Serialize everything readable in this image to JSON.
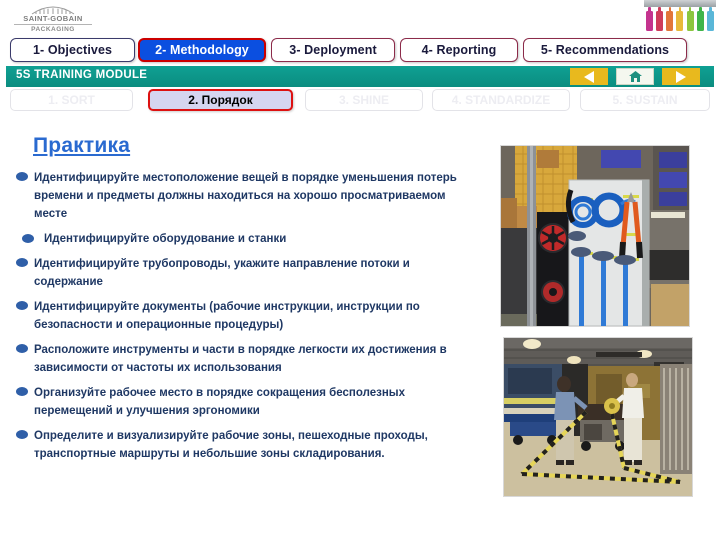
{
  "brand": {
    "name": "SAINT-GOBAIN",
    "division": "PACKAGING",
    "logo_icon": "saint-gobain-arch-icon",
    "bottles_icon": "colored-bottles-icon",
    "bottle_colors": [
      "#c4338e",
      "#cf3b5a",
      "#e2753a",
      "#e8b93a",
      "#8cc63f",
      "#3fb54a",
      "#5ab7d8"
    ]
  },
  "main_tabs": [
    {
      "label": "1- Objectives",
      "active": false
    },
    {
      "label": "2- Methodology",
      "active": true
    },
    {
      "label": "3- Deployment",
      "active": false
    },
    {
      "label": "4- Reporting",
      "active": false
    },
    {
      "label": "5- Recommendations",
      "active": false
    }
  ],
  "module_bar": {
    "title": "5S TRAINING MODULE",
    "prev_icon": "previous-arrow-icon",
    "home_icon": "home-icon",
    "next_icon": "next-arrow-icon"
  },
  "sub_tabs": [
    {
      "label": "1. SORT",
      "active": false
    },
    {
      "label": "2. Порядок",
      "active": true
    },
    {
      "label": "3. SHINE",
      "active": false
    },
    {
      "label": "4. STANDARDIZE",
      "active": false
    },
    {
      "label": "5. SUSTAIN",
      "active": false
    }
  ],
  "content": {
    "title": "Практика",
    "bullets": [
      {
        "text": "Идентифицируйте местоположение вещей в порядке уменьшения потерь времени и предметы должны находиться на хорошо просматриваемом месте",
        "indent": false
      },
      {
        "text": "Идентифицируйте оборудование и станки",
        "indent": true
      },
      {
        "text": "Идентифицируйте трубопроводы, укажите направление потоки и содержание",
        "indent": false
      },
      {
        "text": "Идентифицируйте документы (рабочие инструкции, инструкции по безопасности и операционные процедуры)",
        "indent": false
      },
      {
        "text": "Расположите инструменты и части в порядке легкости их достижения в зависимости от частоты их использования",
        "indent": false
      },
      {
        "text": "Организуйте рабочее место в порядке сокращения бесполезных перемещений и улучшения эргономики",
        "indent": false
      },
      {
        "text": "Определите и визуализируйте рабочие зоны, пешеходные проходы, транспортные маршруты и небольшие зоны складирования.",
        "indent": false
      }
    ]
  },
  "photos": [
    {
      "name": "shadow-board-tools-photo",
      "caption": ""
    },
    {
      "name": "floor-marking-zones-photo",
      "caption": ""
    }
  ],
  "colors": {
    "accent_blue": "#2a6ad0",
    "active_tab_blue": "#0b4fe0",
    "active_tab_border_red": "#cc0000",
    "teal_bar": "#0d9488",
    "nav_yellow": "#e8b91e",
    "text_navy": "#1f3864"
  }
}
